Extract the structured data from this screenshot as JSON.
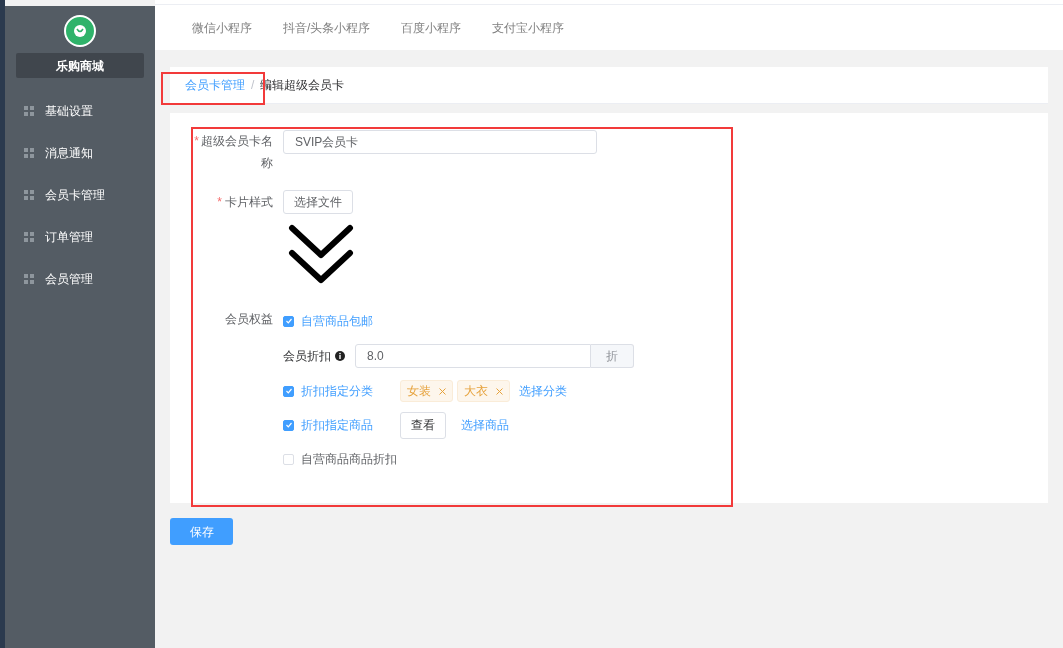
{
  "sidebar": {
    "shop_name": "乐购商城",
    "items": [
      {
        "label": "基础设置"
      },
      {
        "label": "消息通知"
      },
      {
        "label": "会员卡管理"
      },
      {
        "label": "订单管理"
      },
      {
        "label": "会员管理"
      }
    ]
  },
  "tabs": [
    {
      "label": "微信小程序"
    },
    {
      "label": "抖音/头条小程序"
    },
    {
      "label": "百度小程序"
    },
    {
      "label": "支付宝小程序"
    }
  ],
  "breadcrumb": {
    "parent": "会员卡管理",
    "separator": "/",
    "current": "编辑超级会员卡"
  },
  "form": {
    "name_field": {
      "required_mark": "*",
      "label": "超级会员卡名称",
      "value": "SVIP会员卡"
    },
    "style_field": {
      "required_mark": "*",
      "label": "卡片样式",
      "button": "选择文件"
    },
    "benefits": {
      "label": "会员权益",
      "items": [
        {
          "kind": "checkbox",
          "label": "自营商品包邮",
          "checked": true
        },
        {
          "kind": "discount",
          "label": "会员折扣",
          "value": "8.0",
          "unit": "折"
        },
        {
          "kind": "checkbox",
          "label": "折扣指定分类",
          "checked": true,
          "tags": [
            "女装",
            "大衣"
          ],
          "link": "选择分类"
        },
        {
          "kind": "checkbox",
          "label": "折扣指定商品",
          "checked": true,
          "button": "查看",
          "link": "选择商品"
        },
        {
          "kind": "checkbox",
          "label": "自营商品商品折扣",
          "checked": false
        }
      ]
    }
  },
  "save_button": "保存"
}
